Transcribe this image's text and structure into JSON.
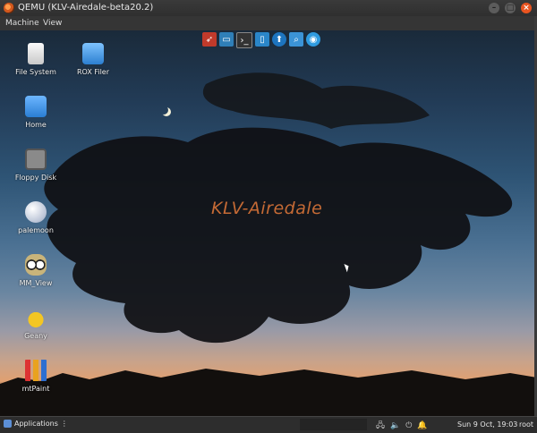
{
  "window": {
    "title": "QEMU (KLV-Airedale-beta20.2)",
    "controls": {
      "minimize": "–",
      "maximize": "□",
      "close": "×"
    }
  },
  "menubar": {
    "items": [
      "Machine",
      "View"
    ]
  },
  "desktop": {
    "brand": "KLV-Airedale",
    "icons": [
      {
        "label": "File System",
        "icon": "drive-icon"
      },
      {
        "label": "ROX Filer",
        "icon": "folder-icon"
      },
      {
        "label": "Home",
        "icon": "home-folder-icon"
      },
      {
        "label": "Floppy Disk",
        "icon": "floppy-icon"
      },
      {
        "label": "palemoon",
        "icon": "moon-icon"
      },
      {
        "label": "MM_View",
        "icon": "owl-icon"
      },
      {
        "label": "Geany",
        "icon": "teapot-icon"
      },
      {
        "label": "mtPaint",
        "icon": "pencils-icon"
      }
    ],
    "launcher": [
      {
        "icon": "rocket-icon",
        "color": "#c03a2b"
      },
      {
        "icon": "screen-icon",
        "color": "#2f7fb8"
      },
      {
        "icon": "terminal-icon",
        "color": "#333333"
      },
      {
        "icon": "phone-icon",
        "color": "#2a86c9"
      },
      {
        "icon": "bird-icon",
        "color": "#1d74bf"
      },
      {
        "icon": "search-icon",
        "color": "#3b93d6"
      },
      {
        "icon": "globe-icon",
        "color": "#2f9be0"
      }
    ]
  },
  "taskbar": {
    "applications_label": "Applications",
    "applications_suffix": "⋮",
    "tray": [
      "network-icon",
      "volume-icon",
      "power-icon",
      "bell-icon"
    ],
    "clock": "Sun  9 Oct, 19:03",
    "user": "root"
  }
}
